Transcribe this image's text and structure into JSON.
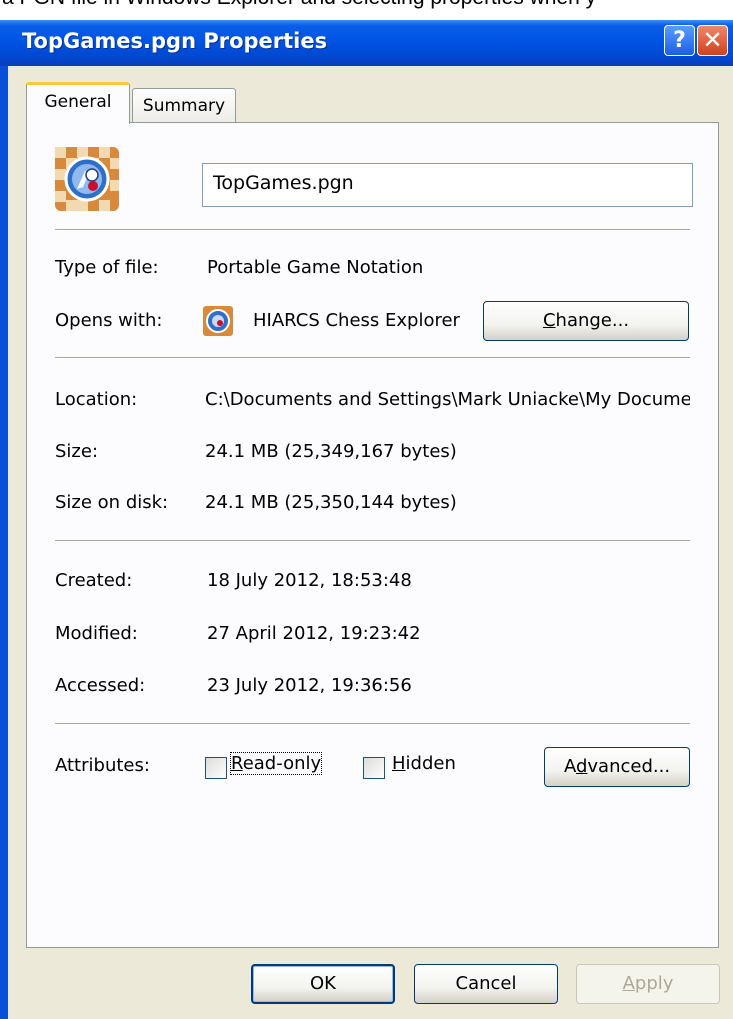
{
  "caption_strip": "a PGN file in Windows Explorer and selecting properties when y",
  "window": {
    "title": "TopGames.pgn Properties",
    "help_glyph": "?",
    "close_glyph": "✕"
  },
  "tabs": [
    {
      "label": "General",
      "active": true
    },
    {
      "label": "Summary",
      "active": false
    }
  ],
  "general": {
    "file_icon": "chess-file-icon",
    "filename": "TopGames.pgn",
    "type_label": "Type of file:",
    "type_value": "Portable Game Notation",
    "opens_label": "Opens with:",
    "opens_value": "HIARCS Chess Explorer",
    "change_button": {
      "mnemonic": "C",
      "rest": "hange..."
    },
    "location_label": "Location:",
    "location_value": "C:\\Documents and Settings\\Mark Uniacke\\My Documents",
    "size_label": "Size:",
    "size_value": "24.1 MB (25,349,167 bytes)",
    "size_on_disk_label": "Size on disk:",
    "size_on_disk_value": "24.1 MB (25,350,144 bytes)",
    "created_label": "Created:",
    "created_value": "18 July 2012, 18:53:48",
    "modified_label": "Modified:",
    "modified_value": "27 April 2012, 19:23:42",
    "accessed_label": "Accessed:",
    "accessed_value": "23 July 2012, 19:36:56",
    "attributes_label": "Attributes:",
    "readonly": {
      "mnemonic": "R",
      "rest": "ead-only",
      "checked": false
    },
    "hidden": {
      "mnemonic": "H",
      "rest": "idden",
      "checked": false
    },
    "advanced_button": {
      "before": "A",
      "mnemonic": "d",
      "rest": "vanced..."
    }
  },
  "footer": {
    "ok": "OK",
    "cancel": "Cancel",
    "apply": {
      "mnemonic": "A",
      "rest": "pply",
      "enabled": false
    }
  }
}
